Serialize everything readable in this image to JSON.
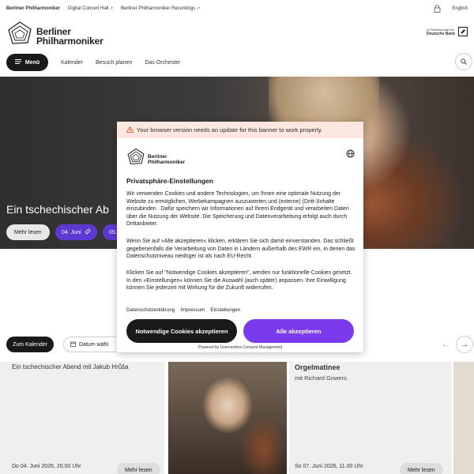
{
  "topbar": {
    "links": [
      "Berliner Philharmoniker",
      "Digital Concert Hall",
      "Berliner Philharmoniker Recordings"
    ],
    "language": "English"
  },
  "header": {
    "logo_line1": "Berliner",
    "logo_line2": "Philharmoniker",
    "sponsor_line1": "In Partnerschaft mit",
    "sponsor_line2": "Deutsche Bank"
  },
  "nav": {
    "menu_label": "Menü",
    "links": [
      "Kalender",
      "Besuch planen",
      "Das Orchester"
    ]
  },
  "hero": {
    "title": "Ein tschechischer Ab",
    "more_label": "Mehr lesen",
    "chip1": "04. Juni",
    "chip2": "05."
  },
  "calendar": {
    "button_label": "Zum Kalender",
    "date_label": "Datum wähl"
  },
  "cards": [
    {
      "title": "Ein tschechischer Abend mit Jakub Hrůša",
      "date": "Do 04. Juni 2026, 20.00 Uhr",
      "more": "Mehr lesen"
    },
    {
      "title": "Orgelmatinee",
      "subtitle": "mit Richard Gowers",
      "date": "So 07. Juni 2026, 11.00 Uhr",
      "more": "Mehr lesen"
    }
  ],
  "consent": {
    "banner": "Your browser version needs an update for this banner to work properly.",
    "logo_line1": "Berliner",
    "logo_line2": "Philharmoniker",
    "title": "Privatsphäre-Einstellungen",
    "para1": "Wir verwenden Cookies und andere Technologien, um Ihnen eine optimale Nutzung der Website zu ermöglichen, Werbekampagnen auszuwerten und (externe) (Dritt-)Inhalte einzubinden . Dafür speichern wir Informationen auf Ihrem Endgerät  und verarbeiten Daten über die Nutzung der Website. Die Speicherung und Datenverarbeitung erfolgt auch durch Drittanbieter.",
    "para2": "Wenn Sie auf »Alle akzeptieren« klicken, erklären Sie sich damit einverstanden. Das  schließt gegebenenfalls die Verarbeitung von Daten in Ländern außerhalb des EWR ein, in denen das Datenschutzniveau niedriger ist als nach EU-Recht.",
    "para3": "Klicken Sie auf \"Notwendige Cookies akzeptieren\", werden nur funktionelle Cookies gesetzt. In den »Einstellungen«  können Sie die Auswahl (auch später) anpassen. Ihre Einwilligung können Sie jederzeit mit Wirkung für die Zukunft widerrufen.",
    "links": [
      "Datenschutzerklärung",
      "Impressum",
      "Einstellungen"
    ],
    "necessary_label": "Notwendige Cookies akzeptieren",
    "accept_all_label": "Alle akzeptieren",
    "powered_by": "Powered by Usercentrics Consent Management"
  },
  "colors": {
    "accent_violet": "#7c3aed",
    "chip_purple": "#5b3ad4",
    "dark": "#1a1a1a",
    "banner_bg": "#fde8e1"
  }
}
